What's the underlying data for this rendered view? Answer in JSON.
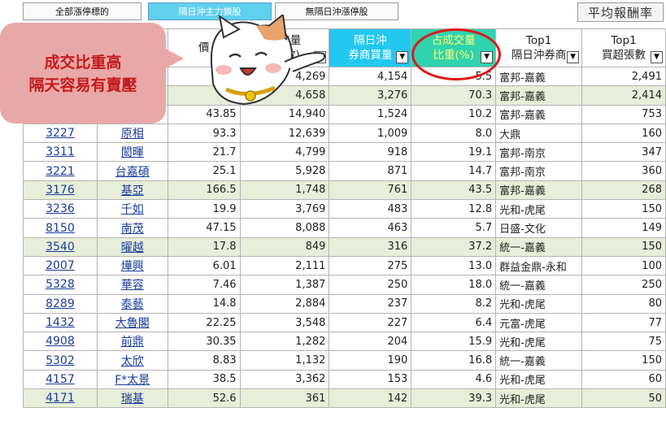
{
  "tabs": [
    {
      "label": "全部漲停標的",
      "active": false
    },
    {
      "label": "隔日沖主力鎖股",
      "active": true
    },
    {
      "label": "無隔日沖漲停股",
      "active": false
    }
  ],
  "avg_button": "平均報酬率",
  "callout": {
    "line1": "成交比重高",
    "line2": "隔天容易有賣壓"
  },
  "headers": {
    "c3": "價",
    "c4_l1": "成交量",
    "c4_l2": "(張數)",
    "c5_l1": "隔日沖",
    "c5_l2": "券商買量",
    "c6_l1": "占成交量",
    "c6_l2": "比重(%)",
    "c7_l1": "Top1",
    "c7_l2": "隔日沖券商",
    "c8_l1": "Top1",
    "c8_l2": "買超張數"
  },
  "rows": [
    {
      "code": "",
      "name": "",
      "price": "",
      "volume": "4,269",
      "buy": "4,154",
      "ratio": "5.5",
      "broker": "富邦-嘉義",
      "net": "2,491",
      "hl": false
    },
    {
      "code": "",
      "name": "",
      "price": "",
      "volume": "4,658",
      "buy": "3,276",
      "ratio": "70.3",
      "broker": "富邦-嘉義",
      "net": "2,414",
      "hl": true
    },
    {
      "code": "",
      "name": "",
      "price": "43.85",
      "volume": "14,940",
      "buy": "1,524",
      "ratio": "10.2",
      "broker": "富邦-嘉義",
      "net": "753",
      "hl": false
    },
    {
      "code": "3227",
      "name": "原相",
      "price": "93.3",
      "volume": "12,639",
      "buy": "1,009",
      "ratio": "8.0",
      "broker": "大鼎",
      "net": "160",
      "hl": false
    },
    {
      "code": "3311",
      "name": "閎暉",
      "price": "21.7",
      "volume": "4,799",
      "buy": "918",
      "ratio": "19.1",
      "broker": "富邦-南京",
      "net": "347",
      "hl": false
    },
    {
      "code": "3221",
      "name": "台嘉碩",
      "price": "25.1",
      "volume": "5,928",
      "buy": "871",
      "ratio": "14.7",
      "broker": "富邦-南京",
      "net": "360",
      "hl": false
    },
    {
      "code": "3176",
      "name": "基亞",
      "price": "166.5",
      "volume": "1,748",
      "buy": "761",
      "ratio": "43.5",
      "broker": "富邦-嘉義",
      "net": "268",
      "hl": true
    },
    {
      "code": "3236",
      "name": "千如",
      "price": "19.9",
      "volume": "3,769",
      "buy": "483",
      "ratio": "12.8",
      "broker": "光和-虎尾",
      "net": "150",
      "hl": false
    },
    {
      "code": "8150",
      "name": "南茂",
      "price": "47.15",
      "volume": "8,088",
      "buy": "463",
      "ratio": "5.7",
      "broker": "日盛-文化",
      "net": "149",
      "hl": false
    },
    {
      "code": "3540",
      "name": "曜越",
      "price": "17.8",
      "volume": "849",
      "buy": "316",
      "ratio": "37.2",
      "broker": "統一-嘉義",
      "net": "150",
      "hl": true
    },
    {
      "code": "2007",
      "name": "燁興",
      "price": "6.01",
      "volume": "2,111",
      "buy": "275",
      "ratio": "13.0",
      "broker": "群益金鼎-永和",
      "net": "100",
      "hl": false
    },
    {
      "code": "5328",
      "name": "華容",
      "price": "7.46",
      "volume": "1,387",
      "buy": "250",
      "ratio": "18.0",
      "broker": "統一-嘉義",
      "net": "250",
      "hl": false
    },
    {
      "code": "8289",
      "name": "泰藝",
      "price": "14.8",
      "volume": "2,884",
      "buy": "237",
      "ratio": "8.2",
      "broker": "光和-虎尾",
      "net": "80",
      "hl": false
    },
    {
      "code": "1432",
      "name": "大魯閣",
      "price": "22.25",
      "volume": "3,548",
      "buy": "227",
      "ratio": "6.4",
      "broker": "元富-虎尾",
      "net": "77",
      "hl": false
    },
    {
      "code": "4908",
      "name": "前鼎",
      "price": "30.35",
      "volume": "1,282",
      "buy": "204",
      "ratio": "15.9",
      "broker": "光和-虎尾",
      "net": "75",
      "hl": false
    },
    {
      "code": "5302",
      "name": "太欣",
      "price": "8.83",
      "volume": "1,132",
      "buy": "190",
      "ratio": "16.8",
      "broker": "統一-嘉義",
      "net": "150",
      "hl": false
    },
    {
      "code": "4157",
      "name": "F*太景",
      "price": "38.5",
      "volume": "3,362",
      "buy": "153",
      "ratio": "4.6",
      "broker": "光和-虎尾",
      "net": "60",
      "hl": false
    },
    {
      "code": "4171",
      "name": "瑞基",
      "price": "52.6",
      "volume": "361",
      "buy": "142",
      "ratio": "39.3",
      "broker": "光和-虎尾",
      "net": "50",
      "hl": true
    }
  ]
}
